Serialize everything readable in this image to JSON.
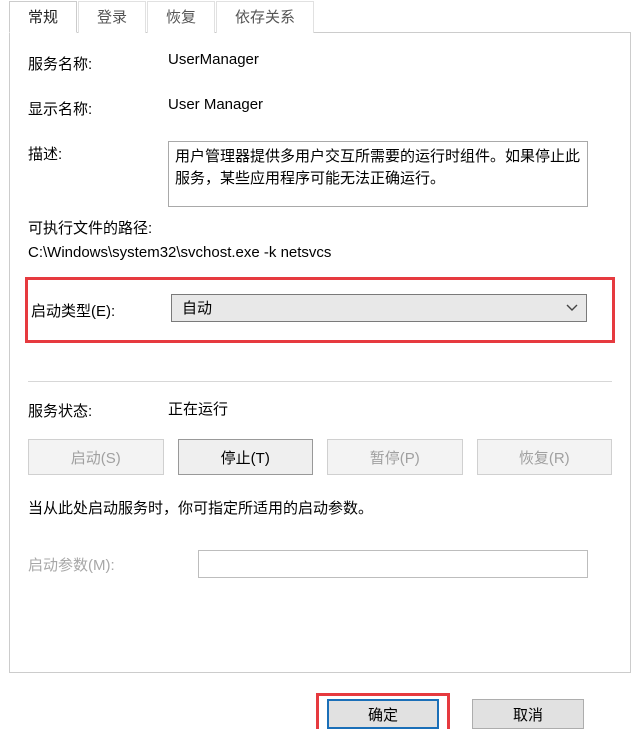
{
  "tabs": {
    "general": "常规",
    "logon": "登录",
    "recovery": "恢复",
    "dependencies": "依存关系"
  },
  "general": {
    "service_name_label": "服务名称:",
    "service_name_value": "UserManager",
    "display_name_label": "显示名称:",
    "display_name_value": "User Manager",
    "description_label": "描述:",
    "description_value": "用户管理器提供多用户交互所需要的运行时组件。如果停止此服务，某些应用程序可能无法正确运行。",
    "exec_path_label": "可执行文件的路径:",
    "exec_path_value": "C:\\Windows\\system32\\svchost.exe -k netsvcs",
    "startup_type_label": "启动类型(E):",
    "startup_type_value": "自动",
    "service_status_label": "服务状态:",
    "service_status_value": "正在运行",
    "btn_start": "启动(S)",
    "btn_stop": "停止(T)",
    "btn_pause": "暂停(P)",
    "btn_resume": "恢复(R)",
    "hint": "当从此处启动服务时，你可指定所适用的启动参数。",
    "start_params_label": "启动参数(M):",
    "start_params_value": ""
  },
  "footer": {
    "ok": "确定",
    "cancel": "取消"
  }
}
